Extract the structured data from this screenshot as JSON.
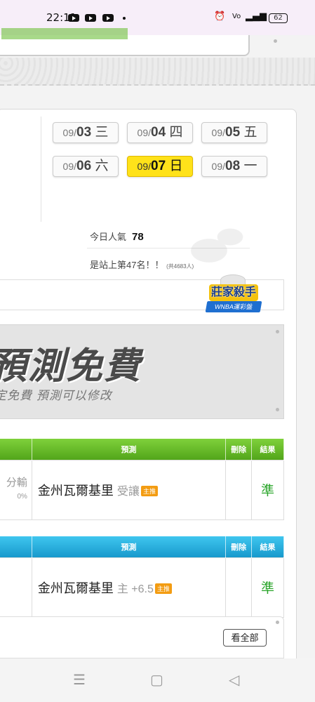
{
  "status": {
    "time": "22:11",
    "battery": "62"
  },
  "dates": [
    {
      "month": "09/",
      "day": "03",
      "weekday": "三",
      "active": false
    },
    {
      "month": "09/",
      "day": "04",
      "weekday": "四",
      "active": false
    },
    {
      "month": "09/",
      "day": "05",
      "weekday": "五",
      "active": false
    },
    {
      "month": "09/",
      "day": "06",
      "weekday": "六",
      "active": false
    },
    {
      "month": "09/",
      "day": "07",
      "weekday": "日",
      "active": true
    },
    {
      "month": "09/",
      "day": "08",
      "weekday": "一",
      "active": false
    }
  ],
  "popularity": {
    "label": "今日人氣",
    "value": "78",
    "rank": "是站上第47名！！",
    "total": "(共4683人)"
  },
  "badge": {
    "title": "莊家殺手",
    "subtitle": "WNBA運彩盤"
  },
  "banner": {
    "title": "預測免費",
    "subtitle": "定免費 預測可以修改"
  },
  "table1": {
    "headers": {
      "predict": "預測",
      "delete": "刪除",
      "result": "結果"
    },
    "left_text": "分輸",
    "left_pct": "0%",
    "pick": "金州瓦爾基里",
    "pick_rest": "受讓",
    "tag": "主推",
    "result": "準"
  },
  "table2": {
    "headers": {
      "predict": "預測",
      "delete": "刪除",
      "result": "結果"
    },
    "pick": "金州瓦爾基里",
    "pick_rest": "主 +6.5",
    "tag": "主推",
    "result": "準"
  },
  "view_all": "看全部"
}
